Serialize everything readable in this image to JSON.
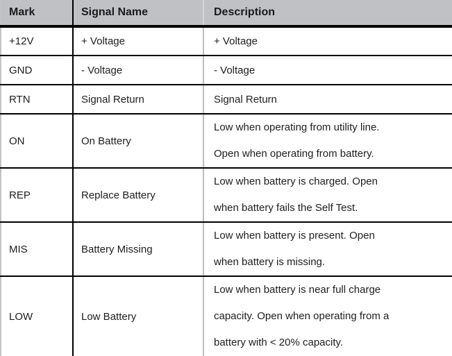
{
  "table": {
    "name": "signal-pin-description-table",
    "columns": [
      {
        "key": "mark",
        "label": "Mark"
      },
      {
        "key": "signal_name",
        "label": "Signal Name"
      },
      {
        "key": "description",
        "label": "Description"
      }
    ],
    "rows": [
      {
        "mark": "+12V",
        "signal_name": "+ Voltage",
        "description_lines": [
          "+ Voltage"
        ]
      },
      {
        "mark": "GND",
        "signal_name": "- Voltage",
        "description_lines": [
          "- Voltage"
        ]
      },
      {
        "mark": "RTN",
        "signal_name": "Signal Return",
        "description_lines": [
          "Signal Return"
        ]
      },
      {
        "mark": "ON",
        "signal_name": "On Battery",
        "description_lines": [
          "Low when operating from utility line.",
          "Open when operating from battery."
        ]
      },
      {
        "mark": "REP",
        "signal_name": "Replace Battery",
        "description_lines": [
          "Low when battery is charged. Open",
          "when battery fails the Self Test."
        ]
      },
      {
        "mark": "MIS",
        "signal_name": "Battery Missing",
        "description_lines": [
          "Low when battery is present. Open",
          "when battery is missing."
        ]
      },
      {
        "mark": "LOW",
        "signal_name": "Low Battery",
        "description_lines": [
          "Low when battery is near full charge",
          "capacity. Open when operating from a",
          "battery with < 20% capacity."
        ]
      }
    ]
  },
  "colors": {
    "header_background": "#c0c1c5",
    "header_text": "#1a1a1a",
    "body_text": "#1d1d1d",
    "body_background": "#ffffff",
    "rule_dark": "#000000",
    "rule_light": "#bdbec2"
  }
}
